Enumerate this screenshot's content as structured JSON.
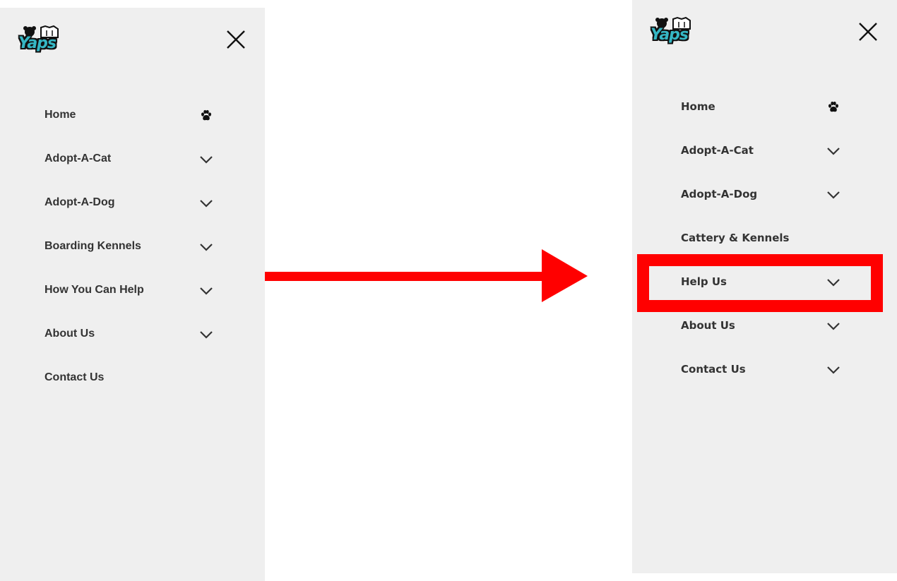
{
  "colors": {
    "panel_bg": "#efefef",
    "text": "#333333",
    "brand_teal": "#35b7c4",
    "highlight": "#ff0000"
  },
  "left_panel": {
    "logo_text": "Yaps",
    "close_icon": "close-icon",
    "menu": [
      {
        "label": "Home",
        "icon": "paw-icon"
      },
      {
        "label": "Adopt-A-Cat",
        "icon": "chevron-down-icon"
      },
      {
        "label": "Adopt-A-Dog",
        "icon": "chevron-down-icon"
      },
      {
        "label": "Boarding Kennels",
        "icon": "chevron-down-icon"
      },
      {
        "label": "How You Can Help",
        "icon": "chevron-down-icon"
      },
      {
        "label": "About Us",
        "icon": "chevron-down-icon"
      },
      {
        "label": "Contact Us",
        "icon": ""
      }
    ]
  },
  "right_panel": {
    "logo_text": "Yaps",
    "close_icon": "close-icon",
    "menu": [
      {
        "label": "Home",
        "icon": "paw-icon"
      },
      {
        "label": "Adopt-A-Cat",
        "icon": "chevron-down-icon"
      },
      {
        "label": "Adopt-A-Dog",
        "icon": "chevron-down-icon"
      },
      {
        "label": "Cattery & Kennels",
        "icon": ""
      },
      {
        "label": "Help Us",
        "icon": "chevron-down-icon",
        "highlighted": true
      },
      {
        "label": "About Us",
        "icon": "chevron-down-icon"
      },
      {
        "label": "Contact Us",
        "icon": "chevron-down-icon"
      }
    ]
  },
  "annotation": {
    "arrow": "right-arrow-icon",
    "highlight": "red-highlight-box"
  }
}
